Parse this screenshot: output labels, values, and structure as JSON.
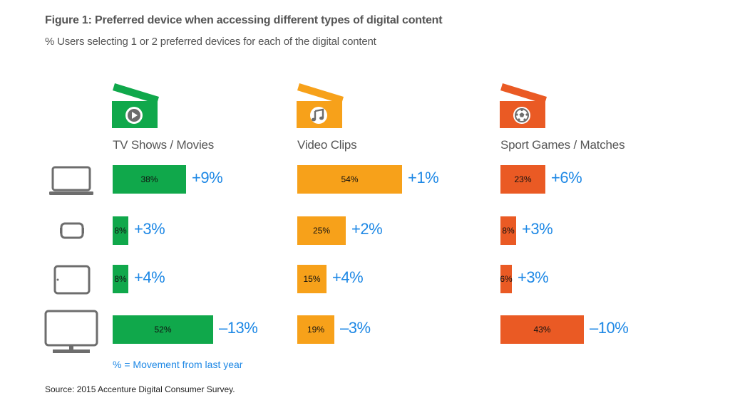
{
  "chart_data": {
    "type": "bar",
    "title": "Figure 1: Preferred device when accessing different types of digital content",
    "subtitle": "% Users selecting 1 or 2 preferred devices for each of the digital content",
    "xlabel": "",
    "ylabel": "",
    "xlim": [
      0,
      100
    ],
    "grid": false,
    "orientation": "horizontal",
    "categories": [
      "Laptop",
      "Smartphone",
      "Tablet",
      "TV"
    ],
    "category_icons": [
      "laptop-icon",
      "smartphone-icon",
      "tablet-icon",
      "tv-icon"
    ],
    "series": [
      {
        "name": "TV Shows / Movies",
        "icon": "play-icon",
        "color": "#10a84b",
        "values": [
          38,
          8,
          8,
          52
        ],
        "labels": [
          "38%",
          "8%",
          "8%",
          "52%"
        ],
        "movement": [
          "+9%",
          "+3%",
          "+4%",
          "-13%"
        ]
      },
      {
        "name": "Video Clips",
        "icon": "music-note-icon",
        "color": "#f7a11a",
        "values": [
          54,
          25,
          15,
          19
        ],
        "labels": [
          "54%",
          "25%",
          "15%",
          "19%"
        ],
        "movement": [
          "+1%",
          "+2%",
          "+4%",
          "-3%"
        ]
      },
      {
        "name": "Sport Games / Matches",
        "icon": "soccer-ball-icon",
        "color": "#ea5a24",
        "values": [
          23,
          8,
          6,
          43
        ],
        "labels": [
          "23%",
          "8%",
          "6%",
          "43%"
        ],
        "movement": [
          "+6%",
          "+3%",
          "+3%",
          "-10%"
        ]
      }
    ],
    "annotations": [
      "% = Movement from last year"
    ],
    "source": "Source: 2015 Accenture Digital Consumer Survey.",
    "movement_color": "#1e88e5"
  }
}
